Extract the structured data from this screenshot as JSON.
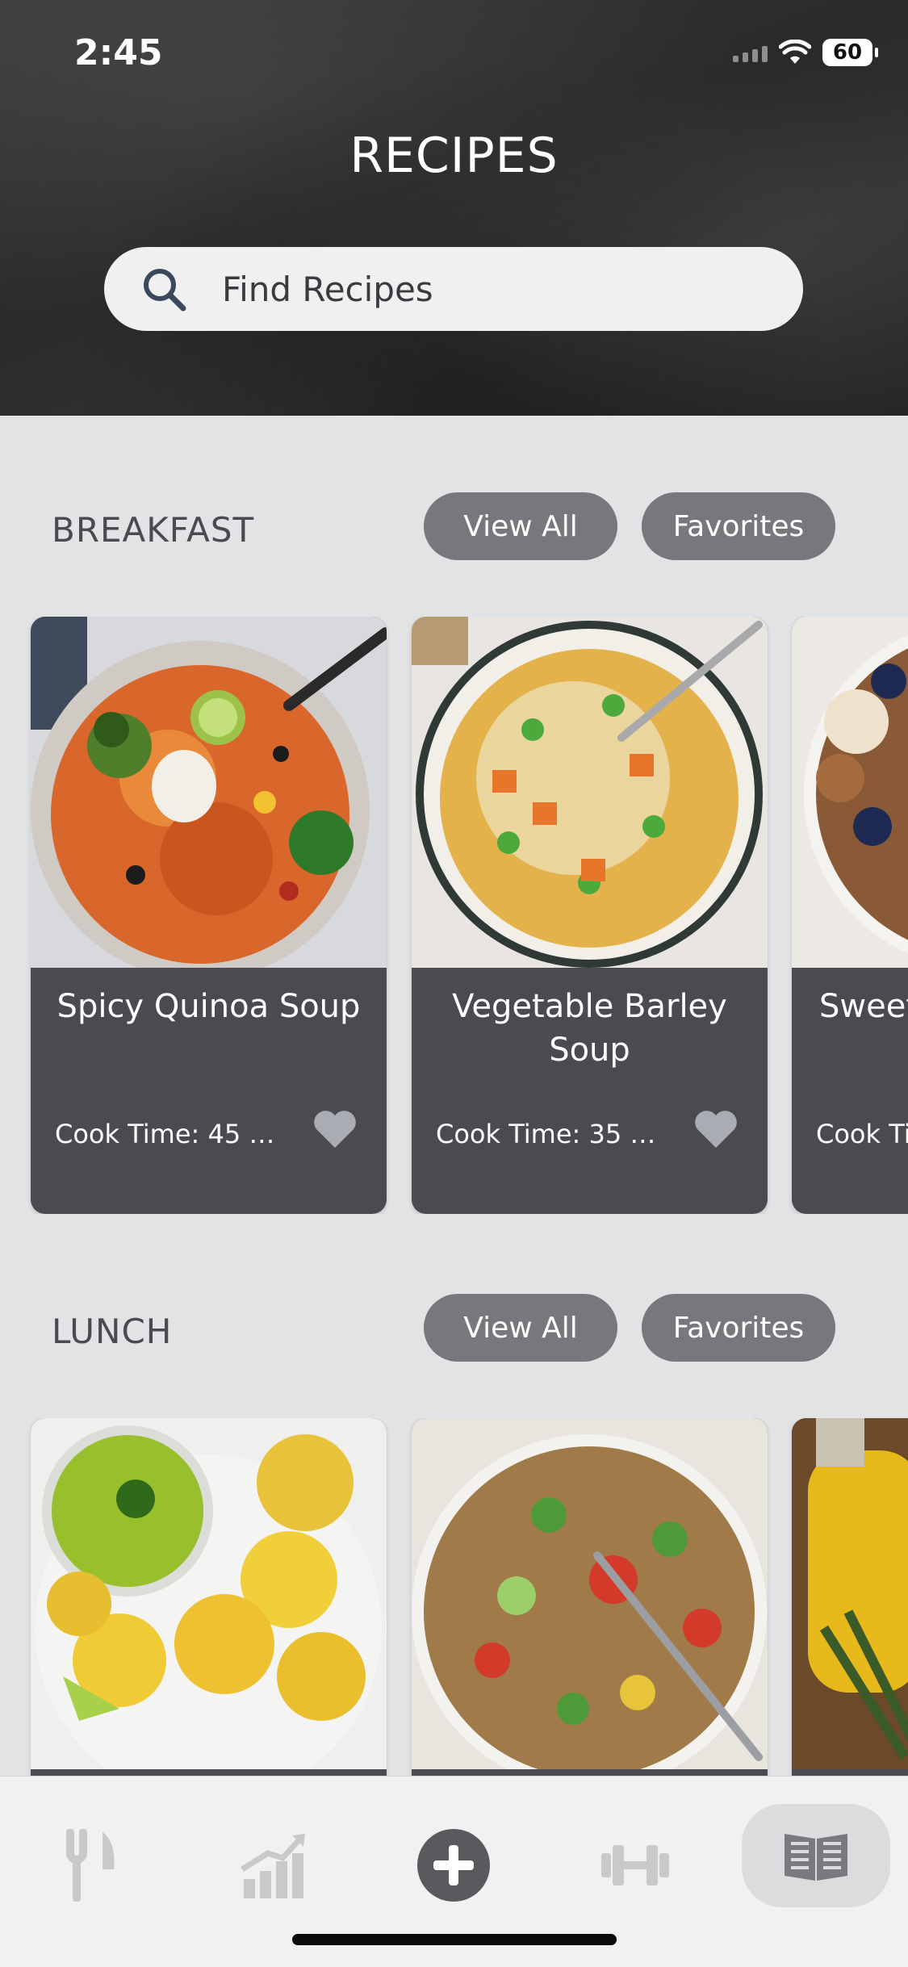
{
  "status": {
    "time": "2:45",
    "battery": "60"
  },
  "header": {
    "title": "RECIPES"
  },
  "search": {
    "placeholder": "Find Recipes"
  },
  "sections": [
    {
      "title": "BREAKFAST",
      "view_all": "View All",
      "favorites": "Favorites",
      "cards": [
        {
          "name": "Spicy Quinoa Soup",
          "cook": "Cook Time: 45 m..."
        },
        {
          "name": "Vegetable Barley Soup",
          "cook": "Cook Time: 35 m..."
        },
        {
          "name": "Sweet Brea",
          "cook": "Cook Ti"
        }
      ]
    },
    {
      "title": "LUNCH",
      "view_all": "View All",
      "favorites": "Favorites",
      "cards": [
        {},
        {},
        {}
      ]
    }
  ],
  "tabbar": {
    "items": [
      {
        "icon": "fork-knife-icon"
      },
      {
        "icon": "trending-chart-icon"
      },
      {
        "icon": "plus-circle-icon"
      },
      {
        "icon": "dumbbell-icon"
      },
      {
        "icon": "recipe-book-icon",
        "active": true
      }
    ]
  },
  "colors": {
    "accent_pill": "#78787c",
    "card_bg": "#4a4a50",
    "page_bg": "#e2e3e4"
  }
}
